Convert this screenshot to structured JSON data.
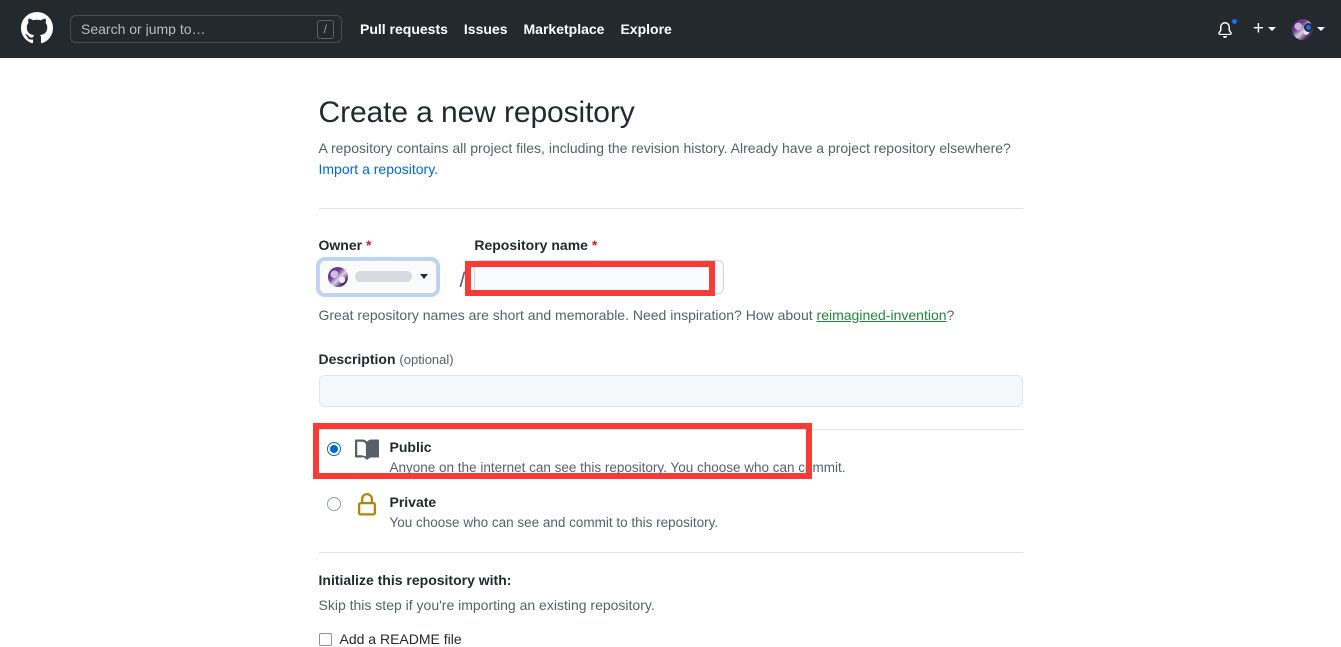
{
  "header": {
    "logo_icon": "github-mark-icon",
    "search": {
      "placeholder": "Search or jump to…",
      "shortcut_badge": "/"
    },
    "nav": [
      {
        "label": "Pull requests"
      },
      {
        "label": "Issues"
      },
      {
        "label": "Marketplace"
      },
      {
        "label": "Explore"
      }
    ],
    "notifications_icon": "bell-icon",
    "has_unread_notifications": true,
    "create_new_icon": "plus-icon",
    "create_new_caret_icon": "chevron-down-icon",
    "avatar_icon": "user-avatar",
    "avatar_caret_icon": "chevron-down-icon",
    "background_color": "#24292e",
    "notification_dot_color": "#1f6feb"
  },
  "page": {
    "title": "Create a new repository",
    "lead_text": "A repository contains all project files, including the revision history. Already have a project repository elsewhere?",
    "import_link": "Import a repository.",
    "link_color": "#0366d6"
  },
  "owner_field": {
    "label": "Owner",
    "required_marker": "*",
    "required_color": "#cb2431",
    "selected_owner_redacted": true,
    "avatar_icon": "user-avatar",
    "caret_icon": "chevron-down-icon",
    "separator": "/"
  },
  "repo_name_field": {
    "label": "Repository name",
    "required_marker": "*",
    "value": "",
    "placeholder": "",
    "highlighted": true,
    "highlight_color": "#f93a36"
  },
  "name_hint": {
    "prefix": "Great repository names are short and memorable. Need inspiration? How about ",
    "suggestion": "reimagined-invention",
    "suffix": "?",
    "suggestion_color": "#22863a"
  },
  "description_field": {
    "label": "Description",
    "optional_note": "(optional)",
    "value": "",
    "placeholder": ""
  },
  "visibility": {
    "options": [
      {
        "id": "public",
        "icon": "repo-book-icon",
        "title": "Public",
        "description": "Anyone on the internet can see this repository. You choose who can commit.",
        "selected": true,
        "highlighted": true,
        "icon_color": "#57606a"
      },
      {
        "id": "private",
        "icon": "lock-icon",
        "title": "Private",
        "description": "You choose who can see and commit to this repository.",
        "selected": false,
        "highlighted": false,
        "icon_color": "#b08800"
      }
    ],
    "selected_radio_color": "#0366d6"
  },
  "initialize": {
    "title": "Initialize this repository with:",
    "subtitle": "Skip this step if you're importing an existing repository.",
    "checkboxes": [
      {
        "label": "Add a README file",
        "checked": false
      }
    ]
  }
}
